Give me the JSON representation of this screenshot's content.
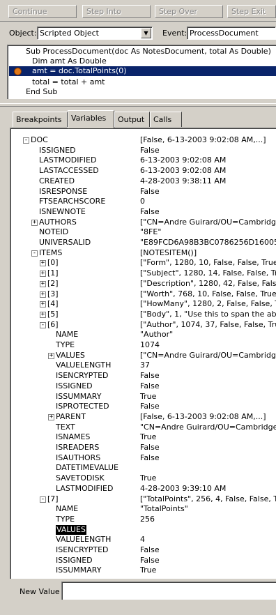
{
  "toolbar": {
    "continue": "Continue",
    "step_into": "Step Into",
    "step_over": "Step Over",
    "step_exit": "Step Exit"
  },
  "selectors": {
    "object_label": "Object:",
    "object_value": "Scripted Object",
    "event_label": "Event:",
    "event_value": "ProcessDocument"
  },
  "code": [
    "Sub ProcessDocument(doc As NotesDocument, total As Double)",
    "Dim amt As Double",
    "amt = doc.TotalPoints(0)",
    "total = total + amt",
    "End Sub"
  ],
  "tabs": [
    "Breakpoints",
    "Variables",
    "Output",
    "Calls"
  ],
  "active_tab": "Variables",
  "variables": [
    {
      "name": "DOC",
      "value": "[False, 6-13-2003 9:02:08 AM,...]",
      "exp": "-"
    },
    {
      "name": "ISSIGNED",
      "value": "False",
      "exp": ""
    },
    {
      "name": "LASTMODIFIED",
      "value": "6-13-2003 9:02:08 AM",
      "exp": ""
    },
    {
      "name": "LASTACCESSED",
      "value": "6-13-2003 9:02:08 AM",
      "exp": ""
    },
    {
      "name": "CREATED",
      "value": "4-28-2003 9:38:11 AM",
      "exp": ""
    },
    {
      "name": "ISRESPONSE",
      "value": "False",
      "exp": ""
    },
    {
      "name": "FTSEARCHSCORE",
      "value": "0",
      "exp": ""
    },
    {
      "name": "ISNEWNOTE",
      "value": "False",
      "exp": ""
    },
    {
      "name": "AUTHORS",
      "value": "[\"CN=Andre Guirard/OU=Cambridge/O",
      "exp": "+"
    },
    {
      "name": "NOTEID",
      "value": "\"8FE\"",
      "exp": ""
    },
    {
      "name": "UNIVERSALID",
      "value": "\"E89FCD6A98B3BC0786256D160050",
      "exp": ""
    },
    {
      "name": "ITEMS",
      "value": "[NOTESITEM()]",
      "exp": "-"
    },
    {
      "name": "[0]",
      "value": "[\"Form\", 1280, 10, False, False, True, F",
      "exp": "+"
    },
    {
      "name": "[1]",
      "value": "[\"Subject\", 1280, 14, False, False, True",
      "exp": "+"
    },
    {
      "name": "[2]",
      "value": "[\"Description\", 1280, 42, False, False, T",
      "exp": "+"
    },
    {
      "name": "[3]",
      "value": "[\"Worth\", 768, 10, False, False, True, Fa",
      "exp": "+"
    },
    {
      "name": "[4]",
      "value": "[\"HowMany\", 1280, 2, False, False, True",
      "exp": "+"
    },
    {
      "name": "[5]",
      "value": "[\"Body\", 1, \"Use this to span the abyss\"",
      "exp": "+"
    },
    {
      "name": "[6]",
      "value": "[\"Author\", 1074, 37, False, False, True,",
      "exp": "-"
    },
    {
      "name": "NAME",
      "value": "\"Author\"",
      "exp": ""
    },
    {
      "name": "TYPE",
      "value": "1074",
      "exp": ""
    },
    {
      "name": "VALUES",
      "value": "[\"CN=Andre Guirard/OU=Cambridge/O",
      "exp": "+"
    },
    {
      "name": "VALUELENGTH",
      "value": "37",
      "exp": ""
    },
    {
      "name": "ISENCRYPTED",
      "value": "False",
      "exp": ""
    },
    {
      "name": "ISSIGNED",
      "value": "False",
      "exp": ""
    },
    {
      "name": "ISSUMMARY",
      "value": "True",
      "exp": ""
    },
    {
      "name": "ISPROTECTED",
      "value": "False",
      "exp": ""
    },
    {
      "name": "PARENT",
      "value": "[False, 6-13-2003 9:02:08 AM,...]",
      "exp": "+"
    },
    {
      "name": "TEXT",
      "value": "\"CN=Andre Guirard/OU=Cambridge/O=",
      "exp": ""
    },
    {
      "name": "ISNAMES",
      "value": "True",
      "exp": ""
    },
    {
      "name": "ISREADERS",
      "value": "False",
      "exp": ""
    },
    {
      "name": "ISAUTHORS",
      "value": "False",
      "exp": ""
    },
    {
      "name": "DATETIMEVALUE",
      "value": "",
      "exp": ""
    },
    {
      "name": "SAVETODISK",
      "value": "True",
      "exp": ""
    },
    {
      "name": "LASTMODIFIED",
      "value": "4-28-2003 9:39:10 AM",
      "exp": ""
    },
    {
      "name": "[7]",
      "value": "[\"TotalPoints\", 256, 4, False, False, Tru",
      "exp": "-"
    },
    {
      "name": "NAME",
      "value": "\"TotalPoints\"",
      "exp": ""
    },
    {
      "name": "TYPE",
      "value": "256",
      "exp": ""
    },
    {
      "name": "VALUES",
      "value": "",
      "exp": ""
    },
    {
      "name": "VALUELENGTH",
      "value": "4",
      "exp": ""
    },
    {
      "name": "ISENCRYPTED",
      "value": "False",
      "exp": ""
    },
    {
      "name": "ISSIGNED",
      "value": "False",
      "exp": ""
    },
    {
      "name": "ISSUMMARY",
      "value": "True",
      "exp": ""
    }
  ],
  "selected_variable": "VALUES",
  "new_value_label": "New Value",
  "new_value": ""
}
